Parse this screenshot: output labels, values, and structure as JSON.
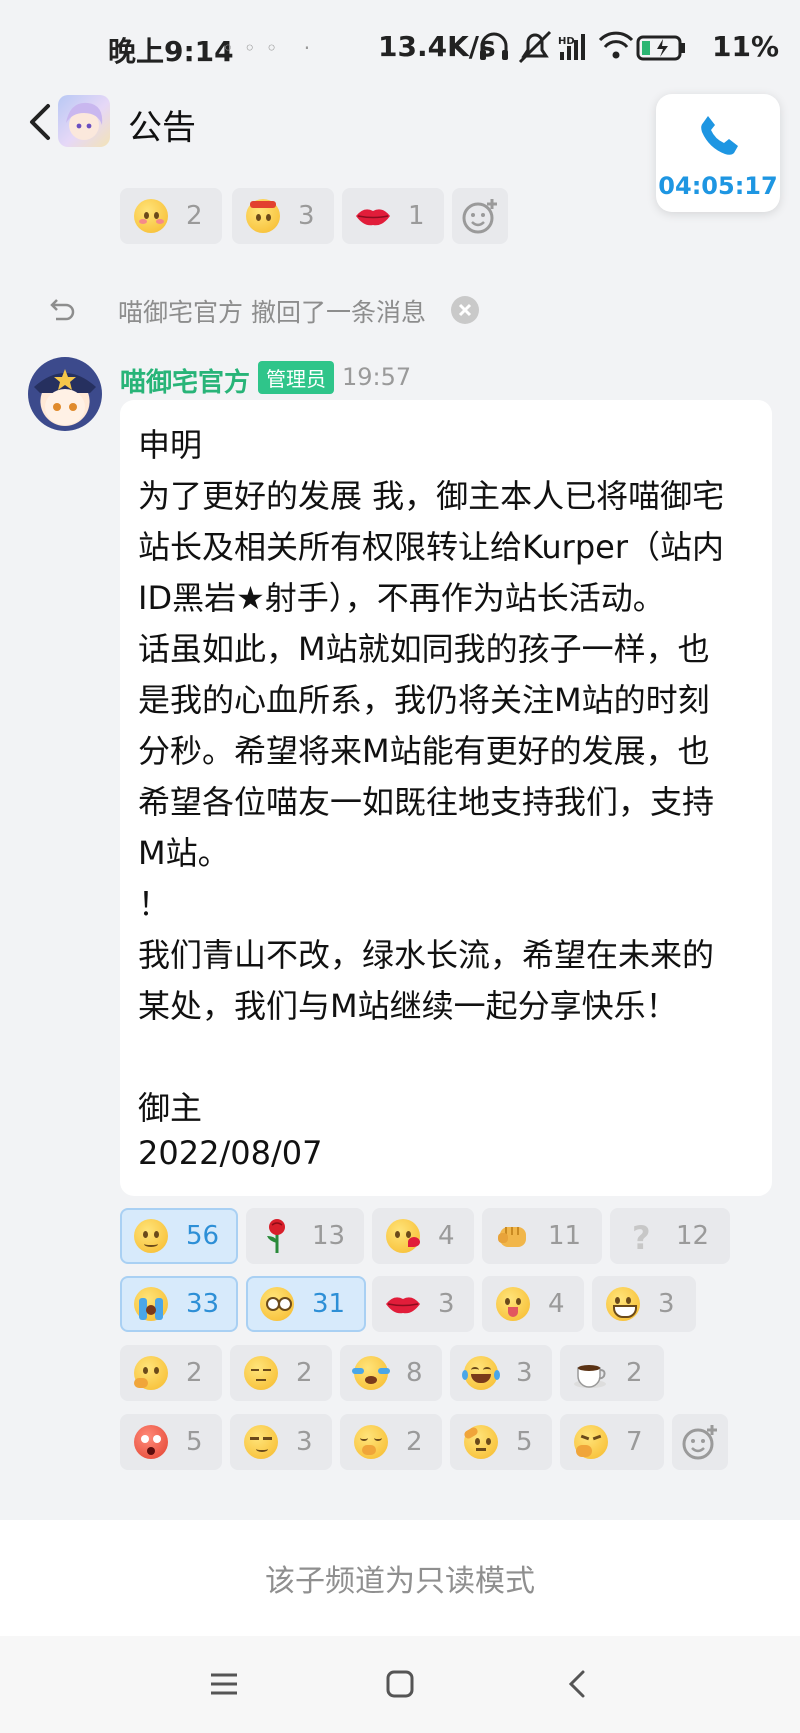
{
  "status_bar": {
    "time": "晚上9:14",
    "net_speed": "13.4K/s",
    "battery": "11%"
  },
  "header": {
    "title": "公告"
  },
  "call": {
    "duration": "04:05:17"
  },
  "prev_reactions": [
    {
      "emoji": "blush",
      "count": "2"
    },
    {
      "emoji": "angry",
      "count": "3"
    },
    {
      "emoji": "lips",
      "count": "1"
    }
  ],
  "recall_notice": "喵御宅官方 撤回了一条消息",
  "message": {
    "sender": "喵御宅官方",
    "badge": "管理员",
    "time": "19:57",
    "lines": [
      "申明",
      "为了更好的发展 我，御主本人已将喵御宅",
      "站长及相关所有权限转让给Kurper（站内",
      "ID黑岩★射手），不再作为站长活动。",
      "话虽如此，M站就如同我的孩子一样，也",
      "是我的心血所系，我仍将关注M站的时刻",
      "分秒。希望将来M站能有更好的发展，也",
      "希望各位喵友一如既往地支持我们，支持",
      "M站。",
      "！",
      "我们青山不改，绿水长流，希望在未来的",
      "某处，我们与M站继续一起分享快乐！",
      "",
      "御主",
      "2022/08/07"
    ]
  },
  "reactions": [
    {
      "emoji": "smile",
      "count": "56",
      "selected": true
    },
    {
      "emoji": "rose",
      "count": "13"
    },
    {
      "emoji": "kiss",
      "count": "4"
    },
    {
      "emoji": "fist",
      "count": "11"
    },
    {
      "emoji": "question",
      "count": "12"
    },
    {
      "emoji": "cry-loud",
      "count": "33",
      "selected": true
    },
    {
      "emoji": "pleading",
      "count": "31",
      "selected": true
    },
    {
      "emoji": "lips",
      "count": "3"
    },
    {
      "emoji": "tongue",
      "count": "4"
    },
    {
      "emoji": "grin",
      "count": "3"
    },
    {
      "emoji": "thinking",
      "count": "2"
    },
    {
      "emoji": "sigh",
      "count": "2"
    },
    {
      "emoji": "tears",
      "count": "8"
    },
    {
      "emoji": "laugh-cry",
      "count": "3"
    },
    {
      "emoji": "coffee",
      "count": "2"
    },
    {
      "emoji": "shocked",
      "count": "5"
    },
    {
      "emoji": "smirk",
      "count": "3"
    },
    {
      "emoji": "giggle",
      "count": "2"
    },
    {
      "emoji": "salute",
      "count": "5"
    },
    {
      "emoji": "facepalm",
      "count": "7"
    }
  ],
  "readonly_notice": "该子频道为只读模式"
}
